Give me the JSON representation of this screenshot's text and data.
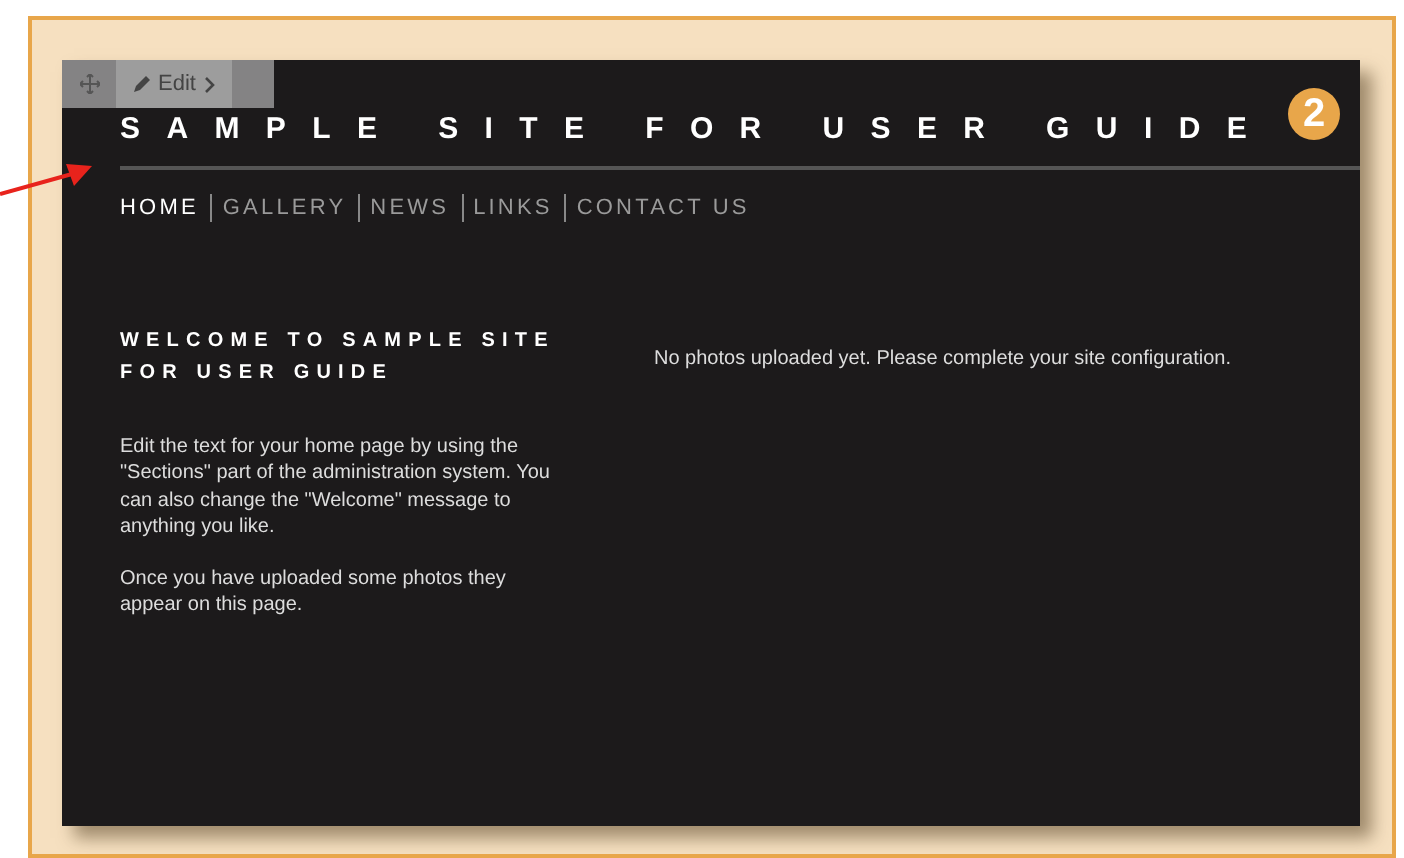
{
  "toolbar": {
    "edit_label": "Edit"
  },
  "site": {
    "title": "SAMPLE SITE FOR USER GUIDE",
    "nav": [
      {
        "label": "HOME",
        "selected": true
      },
      {
        "label": "GALLERY",
        "selected": false
      },
      {
        "label": "NEWS",
        "selected": false
      },
      {
        "label": "LINKS",
        "selected": false
      },
      {
        "label": "CONTACT US",
        "selected": false
      }
    ],
    "heading": "WELCOME TO SAMPLE SITE FOR USER GUIDE",
    "paragraphs": [
      "Edit the text for your home page by using the \"Sections\" part of the administration system. You can also change the \"Welcome\" message to anything you like.",
      "Once you have uploaded some photos they appear on this page."
    ],
    "notice": "No photos uploaded yet. Please complete your site configuration."
  },
  "callout": {
    "number": "2"
  }
}
